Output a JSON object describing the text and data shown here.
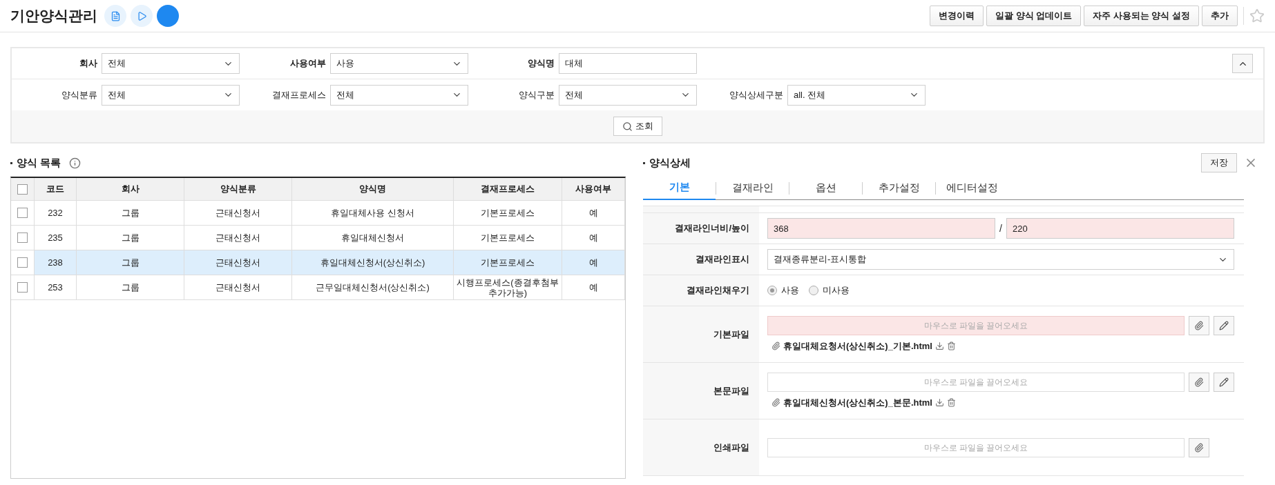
{
  "header": {
    "title": "기안양식관리",
    "buttons": [
      "변경이력",
      "일괄 양식 업데이트",
      "자주 사용되는 양식 설정",
      "추가"
    ],
    "favorite": false
  },
  "filters": [
    {
      "label": "회사",
      "kind": "select",
      "value": "전체",
      "required": true
    },
    {
      "label": "사용여부",
      "kind": "select",
      "value": "사용",
      "required": true
    },
    {
      "label": "양식명",
      "kind": "input",
      "value": "대체",
      "required": true
    },
    {
      "label": "양식분류",
      "kind": "select",
      "value": "전체",
      "required": false
    },
    {
      "label": "결재프로세스",
      "kind": "select",
      "value": "전체",
      "required": false
    },
    {
      "label": "양식구분",
      "kind": "select",
      "value": "전체",
      "required": false
    },
    {
      "label": "양식상세구분",
      "kind": "select",
      "value": "all. 전체",
      "required": false
    }
  ],
  "search_button": "조회",
  "list": {
    "title": "양식 목록",
    "all_checked": false,
    "columns": [
      "코드",
      "회사",
      "양식분류",
      "양식명",
      "결재프로세스",
      "사용여부"
    ],
    "rows": [
      {
        "cells": [
          "232",
          "그룹",
          "근태신청서",
          "휴일대체사용 신청서",
          "기본프로세스",
          "예"
        ],
        "selected": false,
        "checked": false
      },
      {
        "cells": [
          "235",
          "그룹",
          "근태신청서",
          "휴일대체신청서",
          "기본프로세스",
          "예"
        ],
        "selected": false,
        "checked": false
      },
      {
        "cells": [
          "238",
          "그룹",
          "근태신청서",
          "휴일대체신청서(상신취소)",
          "기본프로세스",
          "예"
        ],
        "selected": true,
        "checked": false
      },
      {
        "cells": [
          "253",
          "그룹",
          "근태신청서",
          "근무일대체신청서(상신취소)",
          "시행프로세스(종결후첨부추가가능)",
          "예"
        ],
        "selected": false,
        "checked": false
      }
    ]
  },
  "detail": {
    "title": "양식상세",
    "save_button": "저장",
    "tabs": [
      {
        "label": "기본",
        "selected": true
      },
      {
        "label": "결재라인",
        "selected": false
      },
      {
        "label": "옵션",
        "selected": false
      },
      {
        "label": "추가설정",
        "selected": false
      },
      {
        "label": "에디터설정",
        "selected": false
      }
    ],
    "fields": [
      {
        "kind": "size",
        "label": "결재라인너비/높이",
        "values": [
          "368",
          "220"
        ],
        "separator": "/",
        "required": true
      },
      {
        "kind": "select",
        "label": "결재라인표시",
        "value": "결재종류분리-표시통합"
      },
      {
        "kind": "radio",
        "label": "결재라인채우기",
        "options": [
          {
            "label": "사용",
            "selected": true
          },
          {
            "label": "미사용",
            "selected": false
          }
        ]
      },
      {
        "kind": "file",
        "label": "기본파일",
        "placeholder": "마우스로 파일을 끌어오세요",
        "required": true,
        "editable": true,
        "file": "휴일대체요청서(상신취소)_기본.html"
      },
      {
        "kind": "file",
        "label": "본문파일",
        "placeholder": "마우스로 파일을 끌어오세요",
        "required": false,
        "editable": true,
        "file": "휴일대체신청서(상신취소)_본문.html"
      },
      {
        "kind": "file",
        "label": "인쇄파일",
        "placeholder": "마우스로 파일을 끌어오세요",
        "required": false,
        "editable": false
      }
    ]
  }
}
